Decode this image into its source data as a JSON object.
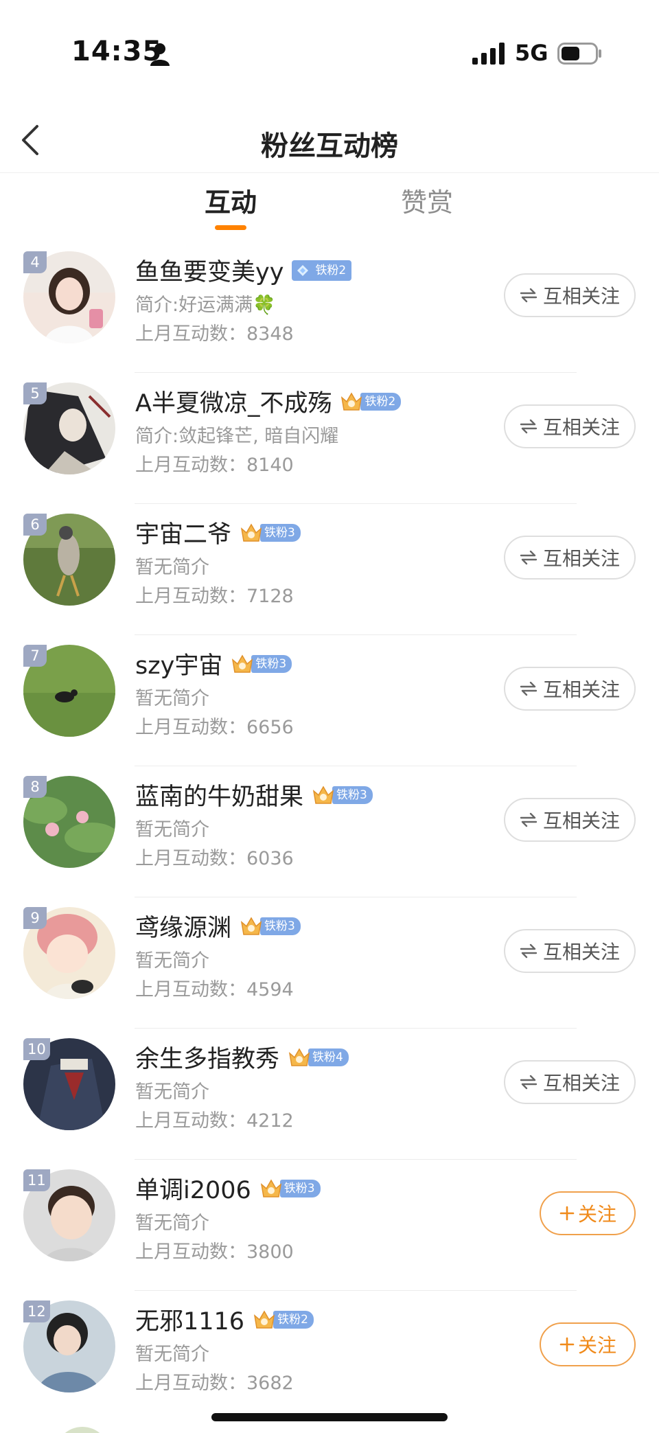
{
  "status_bar": {
    "time": "14:35",
    "network": "5G"
  },
  "nav": {
    "title": "粉丝互动榜"
  },
  "tabs": [
    {
      "label": "互动",
      "active": true
    },
    {
      "label": "赞赏",
      "active": false
    }
  ],
  "accent_color": "#ff8200",
  "fans": [
    {
      "rank": "4",
      "name": "鱼鱼要变美yy",
      "badge_icon": "diamond-icon",
      "badge_level": "铁粉2",
      "bio": "简介:好运满满🍀",
      "count": "上月互动数：8348",
      "button": "互相关注"
    },
    {
      "rank": "5",
      "name": "A半夏微凉_不成殇",
      "badge_icon": "crown-icon",
      "badge_level": "铁粉2",
      "bio": "简介:敛起锋芒, 暗自闪耀",
      "count": "上月互动数：8140",
      "button": "互相关注"
    },
    {
      "rank": "6",
      "name": "宇宙二爷",
      "badge_icon": "crown-icon",
      "badge_level": "铁粉3",
      "bio": "暂无简介",
      "count": "上月互动数：7128",
      "button": "互相关注"
    },
    {
      "rank": "7",
      "name": "szy宇宙",
      "badge_icon": "crown-icon",
      "badge_level": "铁粉3",
      "bio": "暂无简介",
      "count": "上月互动数：6656",
      "button": "互相关注"
    },
    {
      "rank": "8",
      "name": "蓝南的牛奶甜果",
      "badge_icon": "crown-icon",
      "badge_level": "铁粉3",
      "bio": "暂无简介",
      "count": "上月互动数：6036",
      "button": "互相关注"
    },
    {
      "rank": "9",
      "name": "鸢缘源渊",
      "badge_icon": "crown-icon",
      "badge_level": "铁粉3",
      "bio": "暂无简介",
      "count": "上月互动数：4594",
      "button": "互相关注"
    },
    {
      "rank": "10",
      "name": "余生多指教秀",
      "badge_icon": "crown-icon",
      "badge_level": "铁粉4",
      "bio": "暂无简介",
      "count": "上月互动数：4212",
      "button": "互相关注"
    },
    {
      "rank": "11",
      "name": "单调i2006",
      "badge_icon": "crown-icon",
      "badge_level": "铁粉3",
      "bio": "暂无简介",
      "count": "上月互动数：3800",
      "button": "关注"
    },
    {
      "rank": "12",
      "name": "无邪1116",
      "badge_icon": "crown-icon",
      "badge_level": "铁粉2",
      "bio": "暂无简介",
      "count": "上月互动数：3682",
      "button": "关注"
    }
  ]
}
